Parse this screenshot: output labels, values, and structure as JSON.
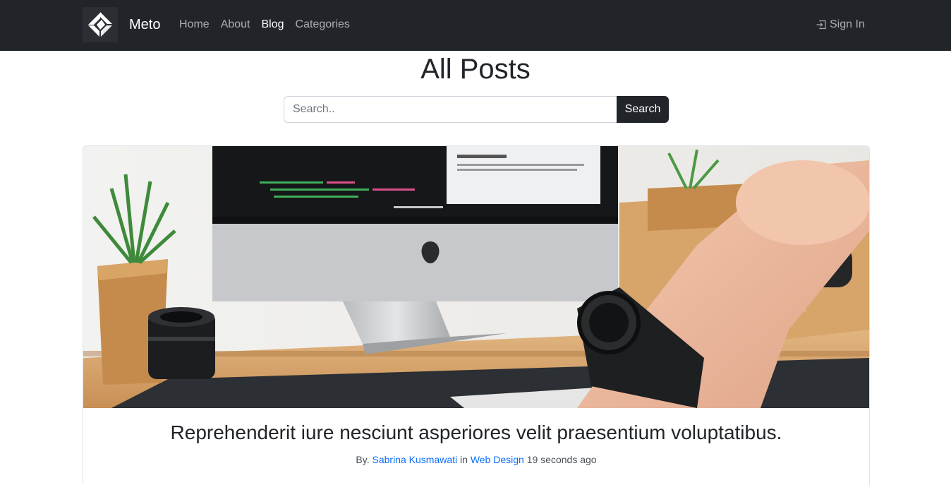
{
  "navbar": {
    "brand_name": "Meto",
    "links": [
      {
        "label": "Home",
        "active": false
      },
      {
        "label": "About",
        "active": false
      },
      {
        "label": "Blog",
        "active": true
      },
      {
        "label": "Categories",
        "active": false
      }
    ],
    "signin_label": "Sign In",
    "signin_icon": "box-arrow-in-right-icon"
  },
  "main": {
    "title": "All Posts",
    "search": {
      "placeholder": "Search..",
      "value": "",
      "button_label": "Search"
    }
  },
  "post": {
    "image_alt": "Desk with iMac computer, camera lens, plant and hand with wristwatch",
    "title": "Reprehenderit iure nesciunt asperiores velit praesentium voluptatibus.",
    "by_label": "By.",
    "author": "Sabrina Kusmawati",
    "in_label": "in",
    "category": "Web Design",
    "time_ago": "19 seconds ago"
  },
  "colors": {
    "navbar_bg": "#212529",
    "link": "#0d6efd",
    "button_bg": "#212529"
  }
}
